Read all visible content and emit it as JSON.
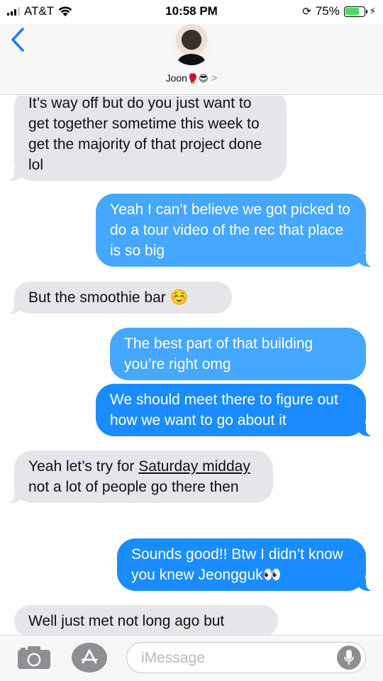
{
  "status_bar": {
    "carrier": "AT&T",
    "time": "10:58 PM",
    "battery_percent": "75%",
    "battery_level": 0.75
  },
  "header": {
    "contact_name": "Joon",
    "contact_emoji": "🥊😎",
    "chevron": ">"
  },
  "messages": [
    {
      "side": "in",
      "text": "It’s way off but do you just want to get together sometime this week to get the majority of that project done lol"
    },
    {
      "side": "out",
      "text": "Yeah I can’t believe we got picked to do a tour video of the rec that place is so big"
    },
    {
      "side": "in",
      "text": "But the smoothie bar ☺️"
    },
    {
      "side": "out",
      "text": "The best part of that building you’re right omg"
    },
    {
      "side": "out",
      "text": "We should meet there to figure out how we want to go about it"
    },
    {
      "side": "in",
      "text_before": "Yeah let’s try for ",
      "link_text": "Saturday midday",
      "text_after": " not a lot of people go there then"
    },
    {
      "side": "out",
      "text": "Sounds good!! Btw I didn’t know you knew Jeongguk👀"
    },
    {
      "side": "in",
      "text": "Well just met not long ago but"
    }
  ],
  "input": {
    "placeholder": "iMessage"
  },
  "icons": {
    "back": "chevron-left-icon",
    "camera": "camera-icon",
    "apps": "app-store-icon",
    "mic": "microphone-icon",
    "wifi": "wifi-icon",
    "orientation_lock": "orientation-lock-icon",
    "charging": "bolt-icon"
  },
  "colors": {
    "outgoing_bubble": "#1a8cff",
    "incoming_bubble": "#e5e5ea",
    "accent": "#147efb"
  }
}
